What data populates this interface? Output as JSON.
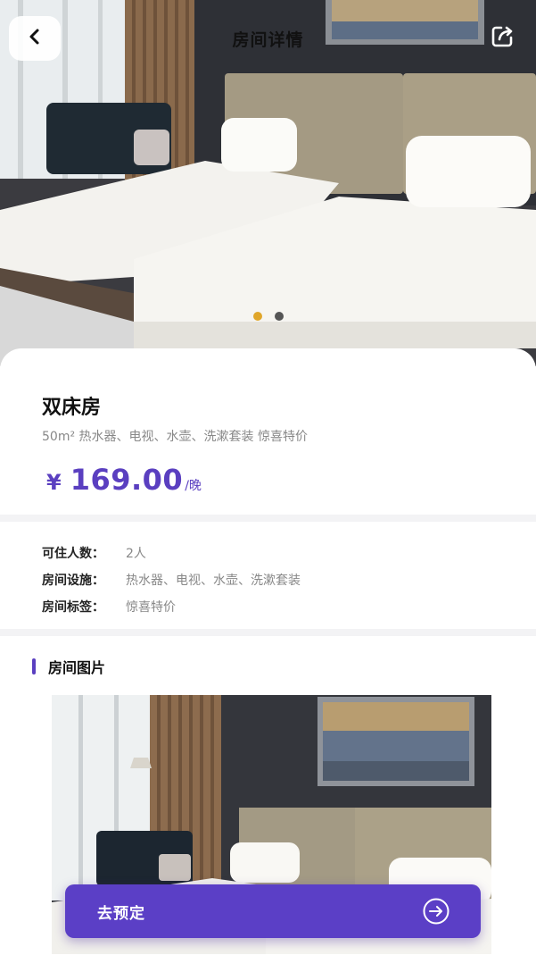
{
  "header": {
    "title": "房间详情",
    "back_icon": "back-arrow-icon",
    "share_icon": "share-icon"
  },
  "carousel": {
    "total": 2,
    "active": 1,
    "active_color": "#e0a62a",
    "inactive_color": "#555555"
  },
  "room": {
    "name": "双床房",
    "description": "50m² 热水器、电视、水壶、洗漱套装 惊喜特价",
    "price_currency": "¥",
    "price_amount": "169.00",
    "price_unit": "/晚"
  },
  "attributes": [
    {
      "label": "可住人数：",
      "value": "2人"
    },
    {
      "label": "房间设施：",
      "value": "热水器、电视、水壶、洗漱套装"
    },
    {
      "label": "房间标签：",
      "value": "惊喜特价"
    }
  ],
  "gallery": {
    "title": "房间图片"
  },
  "book_button": {
    "label": "去预定",
    "icon": "arrow-right-circle-icon"
  },
  "colors": {
    "accent": "#5b3fc6",
    "price": "#5a3fc0"
  }
}
